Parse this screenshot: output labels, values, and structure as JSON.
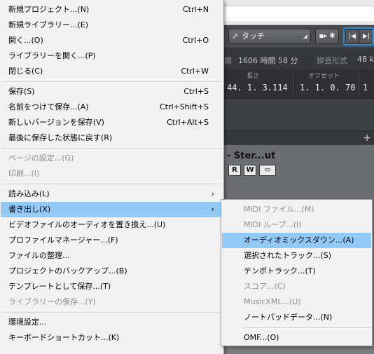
{
  "background": {
    "touch_mode": "タッチ",
    "info": {
      "left_fragment": "間",
      "time_remaining": "1606 時間 58 分",
      "record_format_label": "録音形式",
      "sample_rate_fragment": "48 k"
    },
    "ruler": {
      "length_label": "長さ",
      "length_value": "44. 1. 3.114",
      "offset_label": "オフセット",
      "offset_value": "1. 1. 0. 70",
      "trailing_value": "1"
    },
    "track": {
      "name": "- Ster...ut",
      "read_button": "R",
      "write_button": "W"
    }
  },
  "file_menu": {
    "items": [
      {
        "label": "新規プロジェクト...(N)",
        "shortcut": "Ctrl+N"
      },
      {
        "label": "新規ライブラリー...(E)",
        "shortcut": ""
      },
      {
        "label": "開く...(O)",
        "shortcut": "Ctrl+O"
      },
      {
        "label": "ライブラリーを開く...(P)",
        "shortcut": ""
      },
      {
        "label": "閉じる(C)",
        "shortcut": "Ctrl+W"
      },
      {
        "label": "保存(S)",
        "shortcut": "Ctrl+S"
      },
      {
        "label": "名前をつけて保存...(A)",
        "shortcut": "Ctrl+Shift+S"
      },
      {
        "label": "新しいバージョンを保存(V)",
        "shortcut": "Ctrl+Alt+S"
      },
      {
        "label": "最後に保存した状態に戻す(R)",
        "shortcut": ""
      },
      {
        "label": "ページの設定...(G)",
        "shortcut": ""
      },
      {
        "label": "印刷...(I)",
        "shortcut": ""
      },
      {
        "label": "読み込み(L)",
        "shortcut": ""
      },
      {
        "label": "書き出し(X)",
        "shortcut": ""
      },
      {
        "label": "ビデオファイルのオーディオを置き換え...(U)",
        "shortcut": ""
      },
      {
        "label": "プロファイルマネージャー...(F)",
        "shortcut": ""
      },
      {
        "label": "ファイルの整理...",
        "shortcut": ""
      },
      {
        "label": "プロジェクトのバックアップ...(B)",
        "shortcut": ""
      },
      {
        "label": "テンプレートとして保存...(T)",
        "shortcut": ""
      },
      {
        "label": "ライブラリーの保存...(Y)",
        "shortcut": ""
      },
      {
        "label": "環境設定...",
        "shortcut": ""
      },
      {
        "label": "キーボードショートカット...(K)",
        "shortcut": ""
      }
    ],
    "submenu_arrow": "›"
  },
  "export_submenu": {
    "items": [
      {
        "label": "MIDI ファイル...(M)"
      },
      {
        "label": "MIDI ループ...(I)"
      },
      {
        "label": "オーディオミックスダウン...(A)"
      },
      {
        "label": "選択されたトラック...(S)"
      },
      {
        "label": "テンポトラック...(T)"
      },
      {
        "label": "スコア...(C)"
      },
      {
        "label": "MusicXML...(U)"
      },
      {
        "label": "ノートパッドデータ...(N)"
      },
      {
        "label": "OMF...(O)"
      }
    ]
  },
  "colors": {
    "highlight": "#91c9f7",
    "menu_background": "#f2f2f2",
    "disabled_text": "#8d8d8d",
    "transport_border": "#2f8cd6"
  }
}
